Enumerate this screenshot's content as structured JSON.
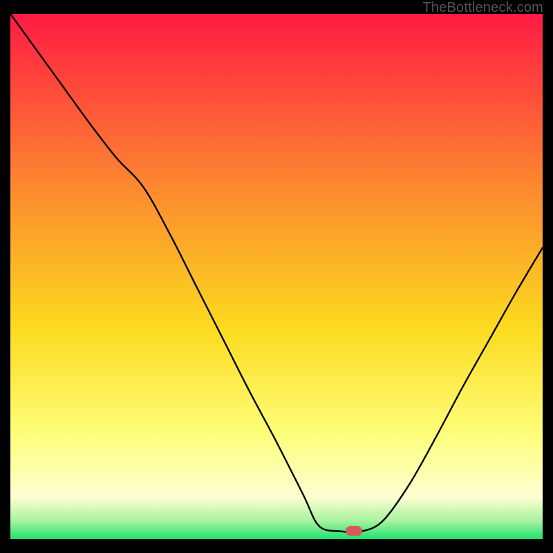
{
  "watermark": "TheBottleneck.com",
  "colors": {
    "background": "#000000",
    "gradient_top": "#fe1b42",
    "gradient_mid1": "#fd8f2e",
    "gradient_mid2": "#fcdb1f",
    "gradient_lowyellow": "#fefe7a",
    "gradient_paleyellow": "#feffd2",
    "gradient_green": "#1ee270",
    "curve": "#000000",
    "marker": "#d55a58"
  },
  "marker": {
    "x_frac": 0.645,
    "y_frac": 0.984
  },
  "chart_data": {
    "type": "line",
    "title": "",
    "xlabel": "",
    "ylabel": "",
    "xlim": [
      0,
      1
    ],
    "ylim": [
      0,
      1
    ],
    "series": [
      {
        "name": "bottleneck-curve",
        "x": [
          0.0,
          0.05,
          0.1,
          0.15,
          0.2,
          0.25,
          0.3,
          0.35,
          0.4,
          0.45,
          0.5,
          0.55,
          0.58,
          0.62,
          0.66,
          0.7,
          0.75,
          0.8,
          0.85,
          0.9,
          0.95,
          1.0
        ],
        "y": [
          1.0,
          0.93,
          0.86,
          0.79,
          0.725,
          0.67,
          0.58,
          0.48,
          0.38,
          0.28,
          0.185,
          0.085,
          0.025,
          0.015,
          0.015,
          0.035,
          0.105,
          0.195,
          0.29,
          0.38,
          0.47,
          0.555
        ]
      }
    ],
    "annotations": [
      {
        "type": "marker",
        "shape": "rounded-rect",
        "x": 0.645,
        "y": 0.016,
        "color": "#d55a58"
      }
    ],
    "gradient_stops": [
      {
        "offset": 0.0,
        "color": "#fe1b42"
      },
      {
        "offset": 0.35,
        "color": "#fd8f2e"
      },
      {
        "offset": 0.6,
        "color": "#fcdb1f"
      },
      {
        "offset": 0.8,
        "color": "#fefe7a"
      },
      {
        "offset": 0.92,
        "color": "#feffd2"
      },
      {
        "offset": 0.965,
        "color": "#a8f3a0"
      },
      {
        "offset": 1.0,
        "color": "#1ee270"
      }
    ]
  }
}
